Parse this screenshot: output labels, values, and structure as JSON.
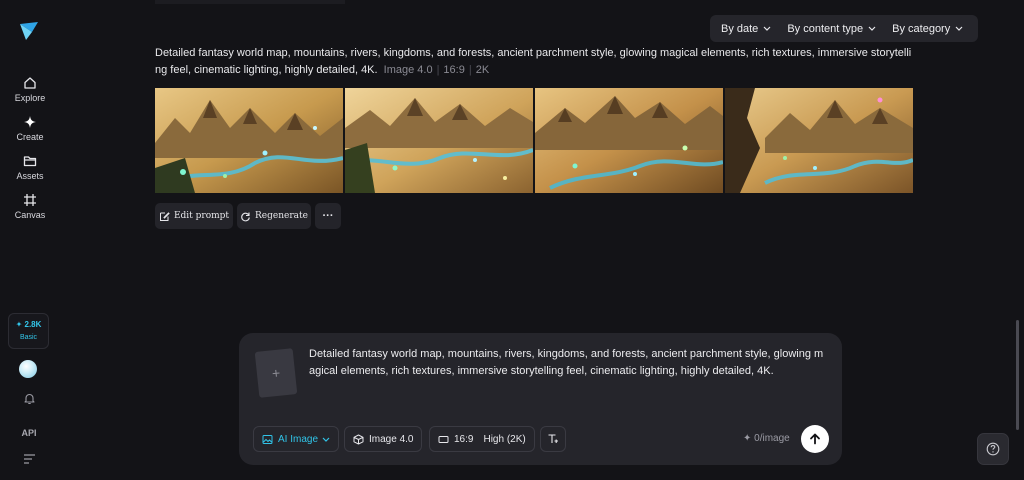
{
  "sidebar": {
    "items": [
      {
        "label": "Explore",
        "icon": "home-icon"
      },
      {
        "label": "Create",
        "icon": "sparkle-icon"
      },
      {
        "label": "Assets",
        "icon": "folder-icon"
      },
      {
        "label": "Canvas",
        "icon": "canvas-icon"
      }
    ],
    "credits": {
      "amount": "✦ 2.8K",
      "plan": "Basic"
    },
    "api_label": "API"
  },
  "filters": [
    {
      "label": "By date"
    },
    {
      "label": "By content type"
    },
    {
      "label": "By category"
    }
  ],
  "generation": {
    "prompt": "Detailed fantasy world map, mountains, rivers, kingdoms, and forests, ancient parchment style, glowing magical elements, rich textures, immersive storytelling feel, cinematic lighting, highly detailed, 4K.",
    "model": "Image 4.0",
    "ratio": "16:9",
    "resolution": "2K",
    "images": [
      {
        "alt": "fantasy map 1"
      },
      {
        "alt": "fantasy map 2"
      },
      {
        "alt": "fantasy map 3"
      },
      {
        "alt": "fantasy map 4"
      }
    ],
    "actions": {
      "edit": "Edit prompt",
      "regenerate": "Regenerate",
      "more": "···"
    }
  },
  "composer": {
    "text": "Detailed fantasy world map, mountains, rivers, kingdoms, and forests, ancient parchment style, glowing magical elements, rich textures, immersive storytelling feel, cinematic lighting, highly detailed, 4K.",
    "add_symbol": "+",
    "mode": "AI Image",
    "model": "Image 4.0",
    "ratio": "16:9",
    "quality": "High (2K)",
    "cost": "✦ 0/image"
  },
  "colors": {
    "accent": "#31c4e8",
    "background": "#131317",
    "panel": "#25252b"
  }
}
